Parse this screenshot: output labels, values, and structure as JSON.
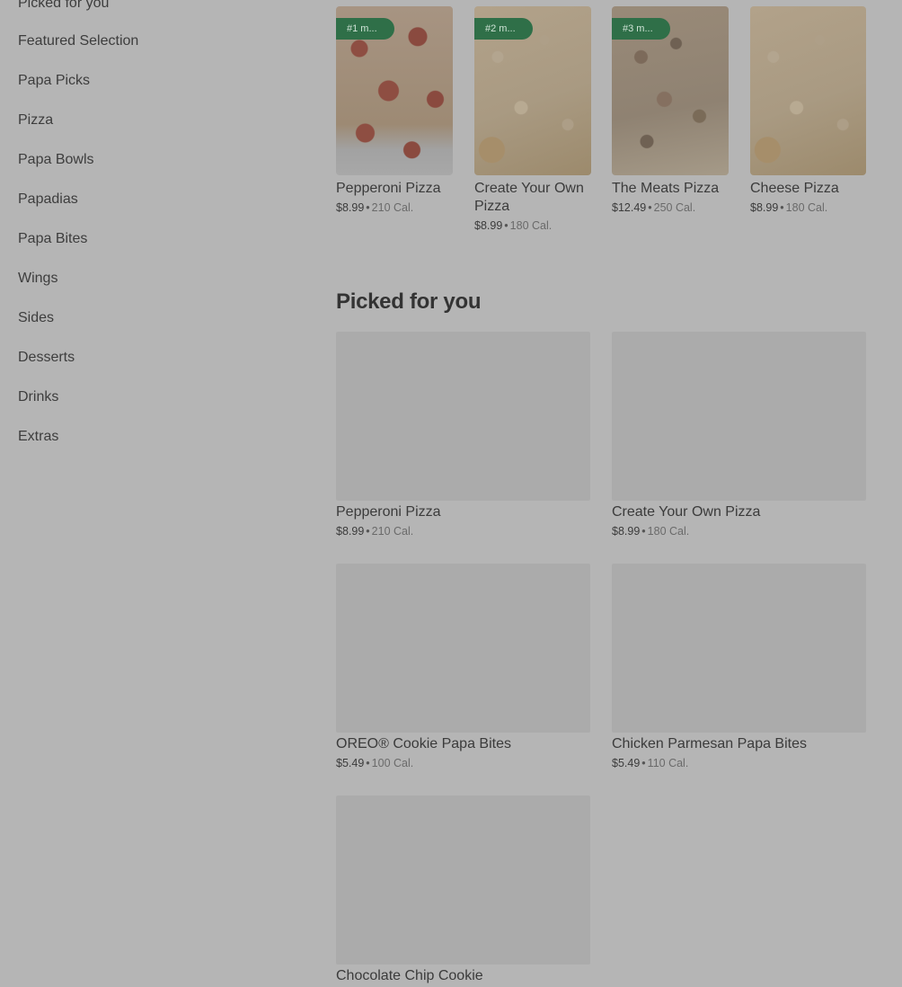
{
  "sidebar": {
    "items": [
      {
        "label": "Picked for you"
      },
      {
        "label": "Featured Selection"
      },
      {
        "label": "Papa Picks"
      },
      {
        "label": "Pizza"
      },
      {
        "label": "Papa Bowls"
      },
      {
        "label": "Papadias"
      },
      {
        "label": "Papa Bites"
      },
      {
        "label": "Wings"
      },
      {
        "label": "Sides"
      },
      {
        "label": "Desserts"
      },
      {
        "label": "Drinks"
      },
      {
        "label": "Extras"
      }
    ]
  },
  "featured": {
    "items": [
      {
        "badge": "#1 m...",
        "name": "Pepperoni Pizza",
        "price": "$8.99",
        "calories": "210 Cal."
      },
      {
        "badge": "#2 m...",
        "name": "Create Your Own Pizza",
        "price": "$8.99",
        "calories": "180 Cal."
      },
      {
        "badge": "#3 m...",
        "name": "The Meats Pizza",
        "price": "$12.49",
        "calories": "250 Cal."
      },
      {
        "name": "Cheese Pizza",
        "price": "$8.99",
        "calories": "180 Cal."
      }
    ]
  },
  "picked": {
    "title": "Picked for you",
    "items": [
      {
        "name": "Pepperoni Pizza",
        "price": "$8.99",
        "calories": "210 Cal."
      },
      {
        "name": "Create Your Own Pizza",
        "price": "$8.99",
        "calories": "180 Cal."
      },
      {
        "name": "OREO® Cookie Papa Bites",
        "price": "$5.49",
        "calories": "100 Cal."
      },
      {
        "name": "Chicken Parmesan Papa Bites",
        "price": "$5.49",
        "calories": "110 Cal."
      },
      {
        "name": "Chocolate Chip Cookie"
      }
    ]
  },
  "colors": {
    "overlay": "#b5b5b5",
    "badge": "#2f6f48"
  },
  "separator": "•"
}
